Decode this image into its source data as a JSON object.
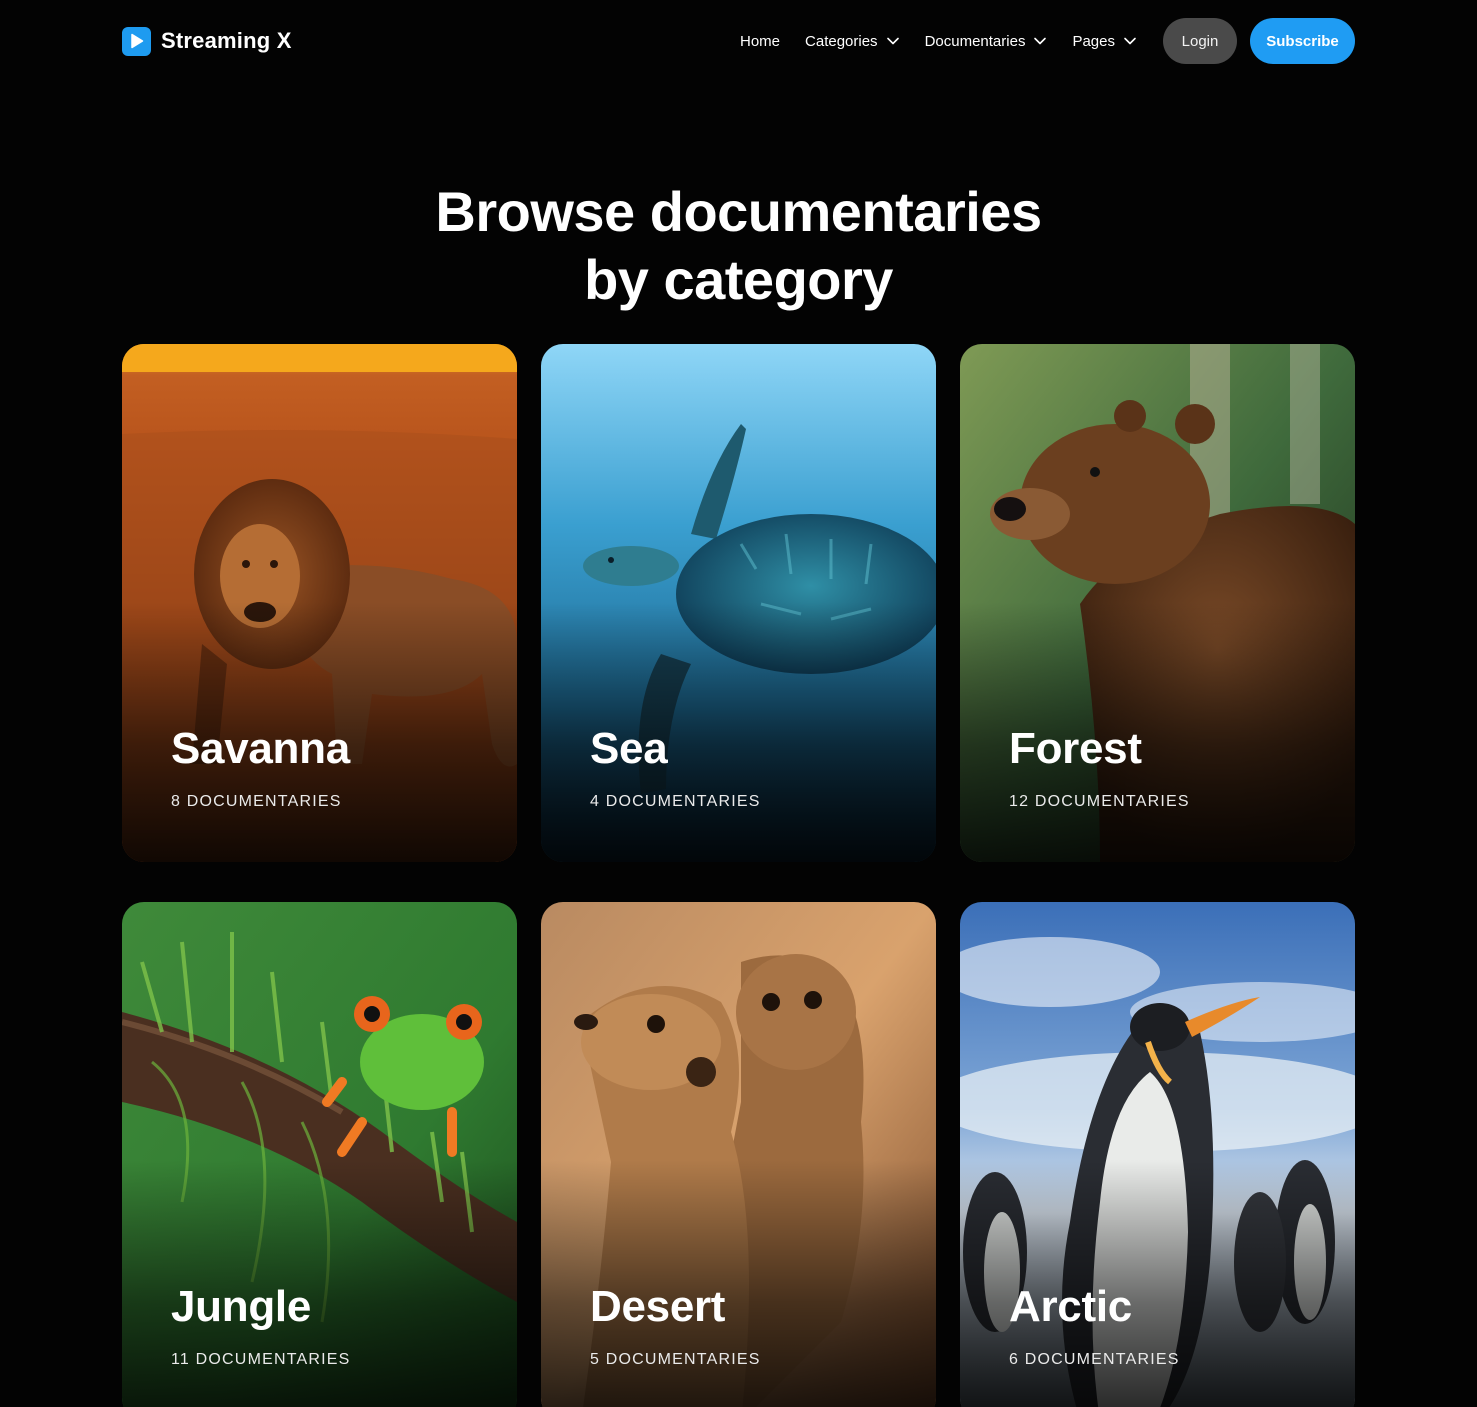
{
  "header": {
    "brand_name": "Streaming X",
    "nav": [
      {
        "label": "Home",
        "has_dropdown": false
      },
      {
        "label": "Categories",
        "has_dropdown": true
      },
      {
        "label": "Documentaries",
        "has_dropdown": true
      },
      {
        "label": "Pages",
        "has_dropdown": true
      }
    ],
    "login_label": "Login",
    "subscribe_label": "Subscribe"
  },
  "main": {
    "heading_line1": "Browse documentaries",
    "heading_line2": "by category",
    "categories": [
      {
        "name": "Savanna",
        "count": "8 DOCUMENTARIES",
        "image": "lion"
      },
      {
        "name": "Sea",
        "count": "4 DOCUMENTARIES",
        "image": "sea-turtle"
      },
      {
        "name": "Forest",
        "count": "12 DOCUMENTARIES",
        "image": "brown-bear"
      },
      {
        "name": "Jungle",
        "count": "11 DOCUMENTARIES",
        "image": "tree-frog"
      },
      {
        "name": "Desert",
        "count": "5 DOCUMENTARIES",
        "image": "meerkats"
      },
      {
        "name": "Arctic",
        "count": "6 DOCUMENTARIES",
        "image": "penguins"
      }
    ]
  },
  "colors": {
    "background": "#030303",
    "accent": "#1f9cf3",
    "login_button": "#4a4a4a"
  }
}
